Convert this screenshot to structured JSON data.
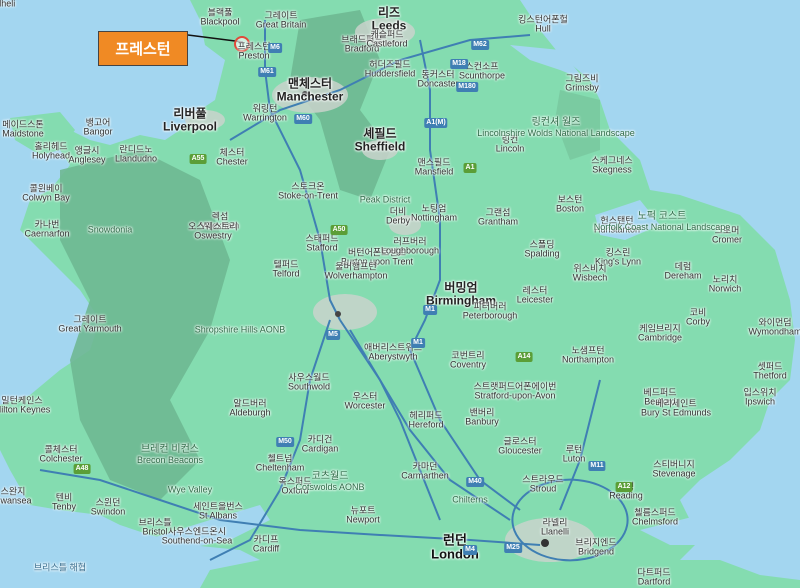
{
  "callout": {
    "label": "프레스턴",
    "target": "Preston"
  },
  "places": [
    {
      "ko": "블랙풀",
      "en": "Blackpool",
      "type": "town"
    },
    {
      "ko": "그레이트",
      "en": "Great Britain",
      "type": "town"
    },
    {
      "ko": "프레스턴",
      "en": "Preston",
      "type": "town"
    },
    {
      "ko": "맨체스터",
      "en": "Manchester",
      "type": "city"
    },
    {
      "ko": "워링턴",
      "en": "Warrington",
      "type": "town"
    },
    {
      "ko": "리버풀",
      "en": "Liverpool",
      "type": "city"
    },
    {
      "ko": "체스터",
      "en": "Chester",
      "type": "town"
    },
    {
      "ko": "리즈",
      "en": "Leeds",
      "type": "city"
    },
    {
      "ko": "브래드퍼드",
      "en": "Bradford",
      "type": "town"
    },
    {
      "ko": "캐슬퍼드",
      "en": "Castleford",
      "type": "town"
    },
    {
      "ko": "허더즈필드",
      "en": "Huddersfield",
      "type": "town"
    },
    {
      "ko": "동커스터",
      "en": "Doncaster",
      "type": "town"
    },
    {
      "ko": "스컨소프",
      "en": "Scunthorpe",
      "type": "town"
    },
    {
      "ko": "킹스턴어폰헐",
      "en": "Hull",
      "type": "town"
    },
    {
      "ko": "그림즈비",
      "en": "Grimsby",
      "type": "town"
    },
    {
      "ko": "셰필드",
      "en": "Sheffield",
      "type": "city"
    },
    {
      "ko": "링컨",
      "en": "Lincoln",
      "type": "town"
    },
    {
      "ko": "맨스필드",
      "en": "Mansfield",
      "type": "town"
    },
    {
      "ko": "스케그네스",
      "en": "Skegness",
      "type": "town"
    },
    {
      "ko": "스토크온",
      "en": "Stoke-on-Trent",
      "type": "town"
    },
    {
      "ko": "노팅엄",
      "en": "Nottingham",
      "type": "town"
    },
    {
      "ko": "더비",
      "en": "Derby",
      "type": "town"
    },
    {
      "ko": "그랜섬",
      "en": "Grantham",
      "type": "town"
    },
    {
      "ko": "보스턴",
      "en": "Boston",
      "type": "town"
    },
    {
      "ko": "헌스탠턴",
      "en": "Hunstanton",
      "type": "town"
    },
    {
      "ko": "크로머",
      "en": "Cromer",
      "type": "town"
    },
    {
      "ko": "렉섬",
      "en": "Wrexham",
      "type": "town"
    },
    {
      "ko": "오스웨스트리",
      "en": "Oswestry",
      "type": "town"
    },
    {
      "ko": "스태퍼드",
      "en": "Stafford",
      "type": "town"
    },
    {
      "ko": "버턴어폰트렌트",
      "en": "Burton upon Trent",
      "type": "town"
    },
    {
      "ko": "러프버러",
      "en": "Loughborough",
      "type": "town"
    },
    {
      "ko": "스폴딩",
      "en": "Spalding",
      "type": "town"
    },
    {
      "ko": "킹스린",
      "en": "King's Lynn",
      "type": "town"
    },
    {
      "ko": "위스비치",
      "en": "Wisbech",
      "type": "town"
    },
    {
      "ko": "데럼",
      "en": "Dereham",
      "type": "town"
    },
    {
      "ko": "노리치",
      "en": "Norwich",
      "type": "town"
    },
    {
      "ko": "텔퍼드",
      "en": "Telford",
      "type": "town"
    },
    {
      "ko": "울버햄프턴",
      "en": "Wolverhampton",
      "type": "town"
    },
    {
      "ko": "버밍엄",
      "en": "Birmingham",
      "type": "city"
    },
    {
      "ko": "레스터",
      "en": "Leicester",
      "type": "town"
    },
    {
      "ko": "피터버러",
      "en": "Peterborough",
      "type": "town"
    },
    {
      "ko": "코비",
      "en": "Corby",
      "type": "town"
    },
    {
      "ko": "와이먼덤",
      "en": "Wymondham",
      "type": "town"
    },
    {
      "ko": "그레이트",
      "en": "Great Yarmouth",
      "type": "town"
    },
    {
      "ko": "애버리스트위스",
      "en": "Aberystwyth",
      "type": "town"
    },
    {
      "ko": "코번트리",
      "en": "Coventry",
      "type": "town"
    },
    {
      "ko": "노샘프턴",
      "en": "Northampton",
      "type": "town"
    },
    {
      "ko": "케임브리지",
      "en": "Cambridge",
      "type": "town"
    },
    {
      "ko": "셋퍼드",
      "en": "Thetford",
      "type": "town"
    },
    {
      "ko": "사우스월드",
      "en": "Southwold",
      "type": "town"
    },
    {
      "ko": "우스터",
      "en": "Worcester",
      "type": "town"
    },
    {
      "ko": "스트랫퍼드어폰에이번",
      "en": "Stratford-upon-Avon",
      "type": "town"
    },
    {
      "ko": "베드퍼드",
      "en": "Bedford",
      "type": "town"
    },
    {
      "ko": "베리세인트",
      "en": "Bury St Edmunds",
      "type": "town"
    },
    {
      "ko": "입스위치",
      "en": "Ipswich",
      "type": "town"
    },
    {
      "ko": "알드버러",
      "en": "Aldeburgh",
      "type": "town"
    },
    {
      "ko": "헤리퍼드",
      "en": "Hereford",
      "type": "town"
    },
    {
      "ko": "밴버리",
      "en": "Banbury",
      "type": "town"
    },
    {
      "ko": "밀턴케인스",
      "en": "Milton Keynes",
      "type": "town"
    },
    {
      "ko": "카디건",
      "en": "Cardigan",
      "type": "town"
    },
    {
      "ko": "첼트넘",
      "en": "Cheltenham",
      "type": "town"
    },
    {
      "ko": "글로스터",
      "en": "Gloucester",
      "type": "town"
    },
    {
      "ko": "루턴",
      "en": "Luton",
      "type": "town"
    },
    {
      "ko": "스티버니지",
      "en": "Stevenage",
      "type": "town"
    },
    {
      "ko": "콜체스터",
      "en": "Colchester",
      "type": "town"
    },
    {
      "ko": "카마던",
      "en": "Carmarthen",
      "type": "town"
    },
    {
      "ko": "옥스퍼드",
      "en": "Oxford",
      "type": "town"
    },
    {
      "ko": "스트라우드",
      "en": "Stroud",
      "type": "town"
    },
    {
      "ko": "세인트올번스",
      "en": "St Albans",
      "type": "town"
    },
    {
      "ko": "뉴포트",
      "en": "Newport",
      "type": "town"
    },
    {
      "ko": "스윈던",
      "en": "Swindon",
      "type": "town"
    },
    {
      "ko": "스완지",
      "en": "Swansea",
      "type": "town"
    },
    {
      "ko": "텐비",
      "en": "Tenby",
      "type": "town"
    },
    {
      "ko": "라넬리",
      "en": "Llanelli",
      "type": "town"
    },
    {
      "ko": "런던",
      "en": "London",
      "type": "cap"
    },
    {
      "ko": "레딩",
      "en": "Reading",
      "type": "town"
    },
    {
      "ko": "첼름스퍼드",
      "en": "Chelmsford",
      "type": "town"
    },
    {
      "ko": "사우스엔드온시",
      "en": "Southend-on-Sea",
      "type": "town"
    },
    {
      "ko": "카디프",
      "en": "Cardiff",
      "type": "town"
    },
    {
      "ko": "브리스틀",
      "en": "Bristol",
      "type": "town"
    },
    {
      "ko": "브리지엔드",
      "en": "Bridgend",
      "type": "town"
    },
    {
      "ko": "다트퍼드",
      "en": "Dartford",
      "type": "town"
    },
    {
      "ko": "메이드스톤",
      "en": "Maidstone",
      "type": "town"
    },
    {
      "ko": "홀리헤드",
      "en": "Holyhead",
      "type": "town"
    },
    {
      "ko": "앵글시",
      "en": "Anglesey",
      "type": "town"
    },
    {
      "ko": "뱅고어",
      "en": "Bangor",
      "type": "town"
    },
    {
      "ko": "란디드노",
      "en": "Llandudno",
      "type": "town"
    },
    {
      "ko": "콜윈베이",
      "en": "Colwyn Bay",
      "type": "town"
    },
    {
      "ko": "카나번",
      "en": "Caernarfon",
      "type": "town"
    },
    {
      "ko": "풀헬리",
      "en": "Pwllheli",
      "type": "town"
    }
  ],
  "regions": [
    {
      "ko": "링컨셔 월즈",
      "en": "Lincolnshire Wolds National Landscape"
    },
    {
      "ko": "노퍽 코스트",
      "en": "Norfolk Coast National Landscape"
    },
    {
      "ko": "코츠월드",
      "en": "Cotswolds AONB"
    },
    {
      "ko": "브레컨 비컨스",
      "en": "Brecon Beacons"
    },
    {
      "ko": "",
      "en": "Wye Valley"
    },
    {
      "ko": "",
      "en": "Shropshire Hills AONB"
    },
    {
      "ko": "",
      "en": "Snowdonia"
    },
    {
      "ko": "",
      "en": "Chilterns"
    },
    {
      "ko": "",
      "en": "Peak District"
    }
  ],
  "roads": [
    {
      "id": "M6",
      "type": "m"
    },
    {
      "id": "M61",
      "type": "m"
    },
    {
      "id": "M62",
      "type": "m"
    },
    {
      "id": "M60",
      "type": "m"
    },
    {
      "id": "M18",
      "type": "m"
    },
    {
      "id": "M180",
      "type": "m"
    },
    {
      "id": "A1(M)",
      "type": "m"
    },
    {
      "id": "A1",
      "type": "a"
    },
    {
      "id": "A55",
      "type": "a"
    },
    {
      "id": "A50",
      "type": "a"
    },
    {
      "id": "A14",
      "type": "a"
    },
    {
      "id": "M1",
      "type": "m"
    },
    {
      "id": "M5",
      "type": "m"
    },
    {
      "id": "M50",
      "type": "m"
    },
    {
      "id": "M40",
      "type": "m"
    },
    {
      "id": "M4",
      "type": "m"
    },
    {
      "id": "M25",
      "type": "m"
    },
    {
      "id": "M11",
      "type": "m"
    },
    {
      "id": "A12",
      "type": "a"
    },
    {
      "id": "A48",
      "type": "a"
    },
    {
      "id": "M1",
      "type": "m"
    }
  ],
  "sea_labels": [
    "브리스틀 해협"
  ],
  "colors": {
    "sea": "#a3d6f0",
    "land": "#84dcb0",
    "hills": "#6fb892",
    "motorway": "#3f7fb3",
    "callout": "#f08a24",
    "urban": "#c9d3cc"
  }
}
